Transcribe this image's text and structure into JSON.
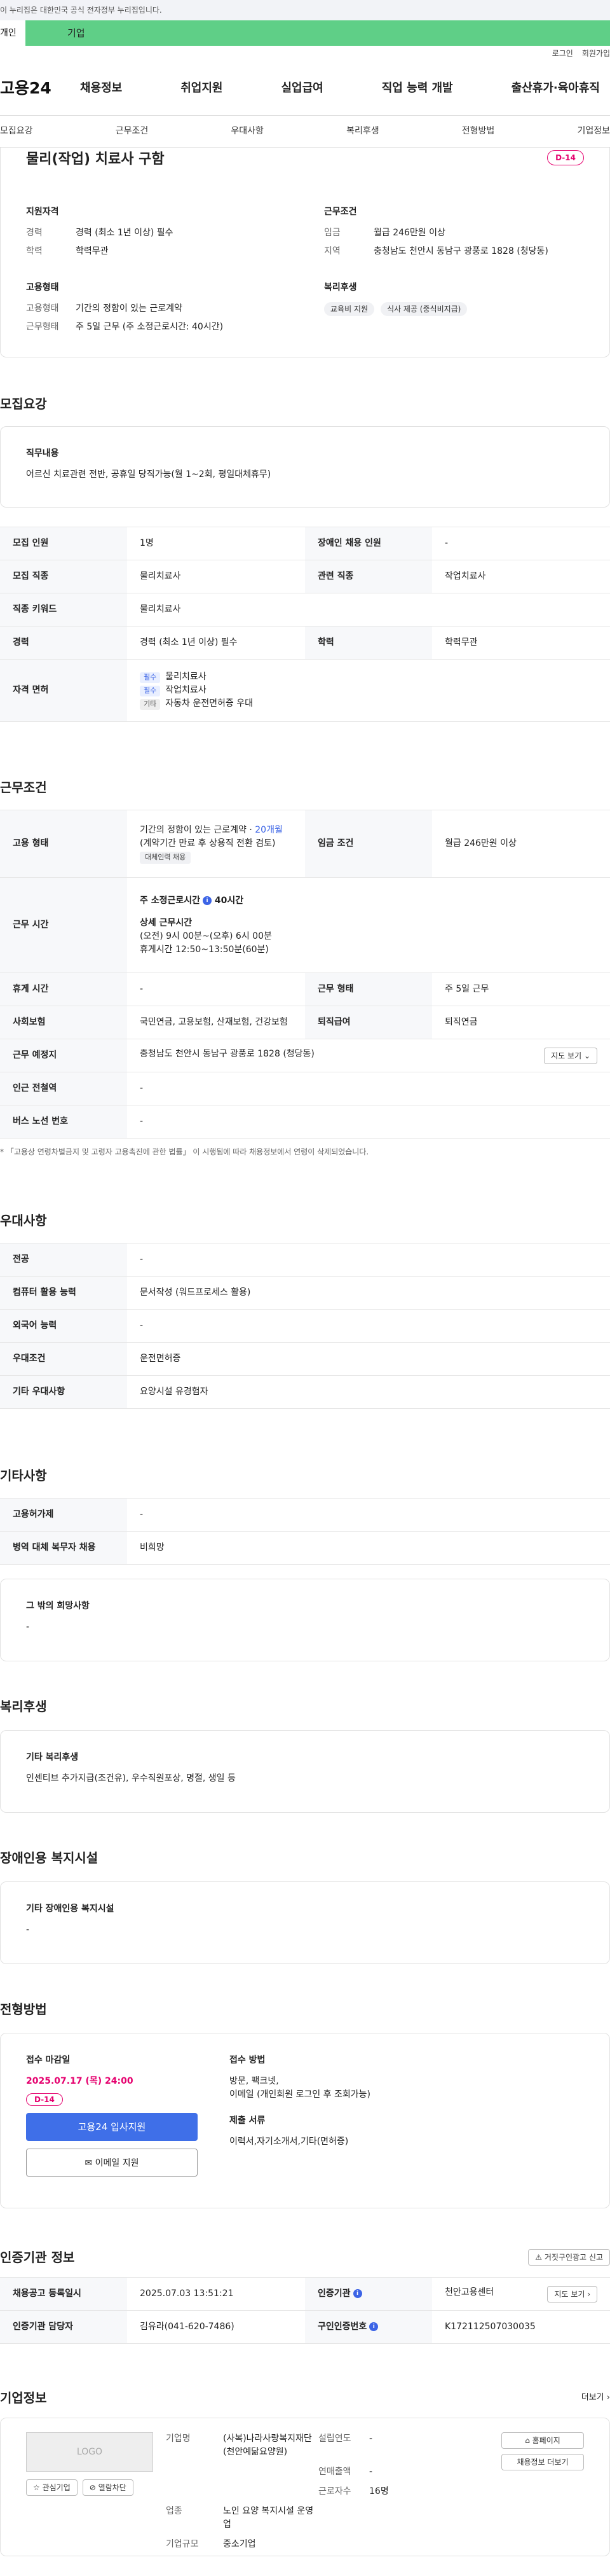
{
  "banner": {
    "gov_text": "이 누리집은 대한민국 공식 전자정부 누리집입니다.",
    "tab_personal": "개인",
    "tab_company": "기업"
  },
  "util": {
    "login": "로그인",
    "join": "회원가입"
  },
  "gnb": {
    "logo": "고용24",
    "menu": [
      "채용정보",
      "취업지원",
      "실업급여",
      "직업 능력 개발",
      "출산휴가·육아휴직"
    ]
  },
  "anchors": [
    "모집요강",
    "근무조건",
    "우대사항",
    "복리후생",
    "전형방법",
    "기업정보"
  ],
  "summary": {
    "title": "물리(작업) 치료사 구함",
    "dday": "D-14",
    "qual_h": "지원자격",
    "qual": [
      {
        "k": "경력",
        "v": "경력 (최소 1년 이상) 필수"
      },
      {
        "k": "학력",
        "v": "학력무관"
      }
    ],
    "cond_h": "근무조건",
    "cond": [
      {
        "k": "임금",
        "v": "월급 246만원 이상"
      },
      {
        "k": "지역",
        "v": "충청남도 천안시 동남구 광풍로 1828 (청당동)"
      }
    ],
    "emp_h": "고용형태",
    "emp": [
      {
        "k": "고용형태",
        "v": "기간의 정함이 있는 근로계약"
      },
      {
        "k": "근무형태",
        "v": "주 5일 근무 (주 소정근로시간: 40시간)"
      }
    ],
    "welfare_h": "복리후생",
    "welfare_chips": [
      "교육비 지원",
      "식사 제공 (중식비지급)"
    ]
  },
  "recruit": {
    "heading": "모집요강",
    "duty_h": "직무내용",
    "duty": "어르신 치료관련 전반, 공휴일 당직가능(월 1~2회, 평일대체휴무)",
    "rows": [
      {
        "k1": "모집 인원",
        "v1": "1명",
        "k2": "장애인 채용 인원",
        "v2": "-"
      },
      {
        "k1": "모집 직종",
        "v1": "물리치료사",
        "k2": "관련 직종",
        "v2": "작업치료사"
      },
      {
        "k1": "직종 키워드",
        "v1": "물리치료사"
      },
      {
        "k1": "경력",
        "v1": "경력 (최소 1년 이상) 필수",
        "k2": "학력",
        "v2": "학력무관"
      }
    ],
    "license_k": "자격 면허",
    "licenses": [
      {
        "tag": "필수",
        "name": "물리치료사"
      },
      {
        "tag": "필수",
        "name": "작업치료사"
      },
      {
        "tag": "기타",
        "name": "자동차 운전면허증 우대"
      }
    ]
  },
  "work": {
    "heading": "근무조건",
    "emp_k": "고용 형태",
    "emp_v1": "기간의 정함이 있는 근로계약 · ",
    "emp_v1b": "20개월",
    "emp_v2": "(계약기간 만료 후 상용직 전환 검토)",
    "emp_tag": "대체인력 채용",
    "wage_k": "임금 조건",
    "wage_v": "월급 246만원 이상",
    "time_k": "근무 시간",
    "time_main": "주 소정근로시간",
    "time_main_v": "40시간",
    "time_detail_h": "상세 근무시간",
    "time_d1": "(오전) 9시 00분~(오후) 6시 00분",
    "time_d2": "휴게시간 12:50~13:50분(60분)",
    "rows": [
      {
        "k1": "휴게 시간",
        "v1": "-",
        "k2": "근무 형태",
        "v2": "주 5일 근무"
      },
      {
        "k1": "사회보험",
        "v1": "국민연금, 고용보험, 산재보험, 건강보험",
        "k2": "퇴직급여",
        "v2": "퇴직연금"
      }
    ],
    "loc_k": "근무 예정지",
    "loc_v": "충청남도 천안시 동남구 광풍로 1828 (청당동)",
    "map_btn": "지도 보기",
    "subway_k": "인근 전철역",
    "subway_v": "-",
    "bus_k": "버스 노선 번호",
    "bus_v": "-",
    "note": "* 「고용상 연령차별금지 및 고령자 고용촉진에 관한 법률」 이 시행됨에 따라 채용정보에서 연령이 삭제되었습니다."
  },
  "pref": {
    "heading": "우대사항",
    "rows": [
      {
        "k": "전공",
        "v": "-"
      },
      {
        "k": "컴퓨터 활용 능력",
        "v": "문서작성 (워드프로세스 활용)"
      },
      {
        "k": "외국어 능력",
        "v": "-"
      },
      {
        "k": "우대조건",
        "v": "운전면허증"
      },
      {
        "k": "기타 우대사항",
        "v": "요양시설 유경험자"
      }
    ]
  },
  "etc": {
    "heading": "기타사항",
    "rows": [
      {
        "k": "고용허가제",
        "v": "-"
      },
      {
        "k": "병역 대체 복무자 채용",
        "v": "비희망"
      }
    ],
    "hope_h": "그 밖의 희망사항",
    "hope_v": "-"
  },
  "benefit": {
    "heading": "복리후생",
    "box_h": "기타 복리후생",
    "box_v": "인센티브 추가지급(조건유), 우수직원포상, 명절, 생일 등"
  },
  "disab": {
    "heading": "장애인용 복지시설",
    "box_h": "기타 장애인용 복지시설",
    "box_v": "-"
  },
  "selection": {
    "heading": "전형방법",
    "deadline_h": "접수 마감일",
    "deadline": "2025.07.17 (목) 24:00",
    "dday": "D-14",
    "apply_btn": "고용24 입사지원",
    "email_btn": "이메일 지원",
    "method_h": "접수 방법",
    "method_1": "방문, 팩크넷,",
    "method_2": "이메일 (개인회원 로그인 후 조회가능)",
    "docs_h": "제출 서류",
    "docs": "이력서,자기소개서,기타(면허증)"
  },
  "cert": {
    "heading": "인증기관 정보",
    "report_btn": "거짓구인광고 신고",
    "r1k1": "채용공고 등록일시",
    "r1v1": "2025.07.03 13:51:21",
    "r1k2": "인증기관",
    "r1v2": "천안고용센터",
    "map_btn": "지도 보기",
    "r2k1": "인증기관 담당자",
    "r2v1": "김유라(041-620-7486)",
    "r2k2": "구인인증번호",
    "r2v2": "K172112507030035"
  },
  "company": {
    "heading": "기업정보",
    "more": "더보기",
    "logo": "LOGO",
    "fav_btn": "관심기업",
    "block_btn": "열람차단",
    "k_name": "기업명",
    "v_name": "(사복)나라사랑복지재단(천안예닮요양원)",
    "k_year": "설립연도",
    "v_year": "-",
    "k_sales": "연매출액",
    "v_sales": "-",
    "k_emp": "근로자수",
    "v_emp": "16명",
    "k_biz": "업종",
    "v_biz": "노인 요양 복지시설 운영업",
    "k_size": "기업규모",
    "v_size": "중소기업",
    "home_btn": "홈페이지",
    "jobs_btn": "채용정보 더보기"
  }
}
